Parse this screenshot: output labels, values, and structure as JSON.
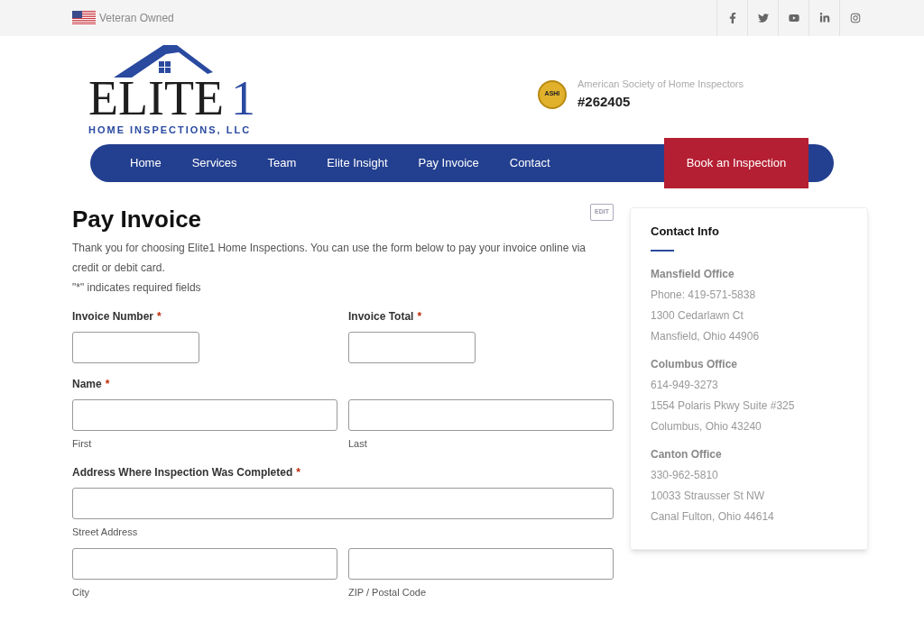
{
  "topbar": {
    "badge": "Veteran Owned"
  },
  "logo": {
    "word": "ELITE",
    "numeral": "1",
    "tagline": "HOME INSPECTIONS, LLC"
  },
  "association": {
    "seal": "ASHI",
    "name": "American Society of Home Inspectors",
    "number": "#262405"
  },
  "nav": {
    "items": [
      "Home",
      "Services",
      "Team",
      "Elite Insight",
      "Pay Invoice",
      "Contact"
    ],
    "cta": "Book an Inspection"
  },
  "page": {
    "title": "Pay Invoice",
    "edit": "EDIT",
    "intro": "Thank you for choosing Elite1 Home Inspections. You can use the form below to pay your invoice online via credit or debit card.",
    "required_note": "\"*\" indicates required fields"
  },
  "form": [
    {
      "kind": "pair",
      "fields": [
        {
          "label": "Invoice Number",
          "required_mark": "*"
        },
        {
          "label": "Invoice Total",
          "required_mark": "*"
        }
      ]
    },
    {
      "kind": "group",
      "label": "Name",
      "required_mark": "*",
      "inputs": [
        {
          "sublabel": "First",
          "wide": false
        },
        {
          "sublabel": "Last",
          "wide": false
        }
      ]
    },
    {
      "kind": "group",
      "label": "Address Where Inspection Was Completed",
      "required_mark": "*",
      "inputs": [
        {
          "sublabel": "Street Address",
          "wide": true
        },
        {
          "sublabel": "City",
          "wide": false
        },
        {
          "sublabel": "ZIP / Postal Code",
          "wide": false
        }
      ]
    }
  ],
  "contact": {
    "title": "Contact Info",
    "offices": [
      {
        "name": "Mansfield Office",
        "lines": [
          "Phone: 419-571-5838",
          "1300 Cedarlawn Ct",
          "Mansfield, Ohio 44906"
        ]
      },
      {
        "name": "Columbus Office",
        "lines": [
          "614-949-3273",
          "1554 Polaris Pkwy Suite #325",
          "Columbus, Ohio 43240"
        ]
      },
      {
        "name": "Canton Office",
        "lines": [
          "330-962-5810",
          "10033 Strausser St NW",
          "Canal Fulton, Ohio 44614"
        ]
      }
    ]
  }
}
